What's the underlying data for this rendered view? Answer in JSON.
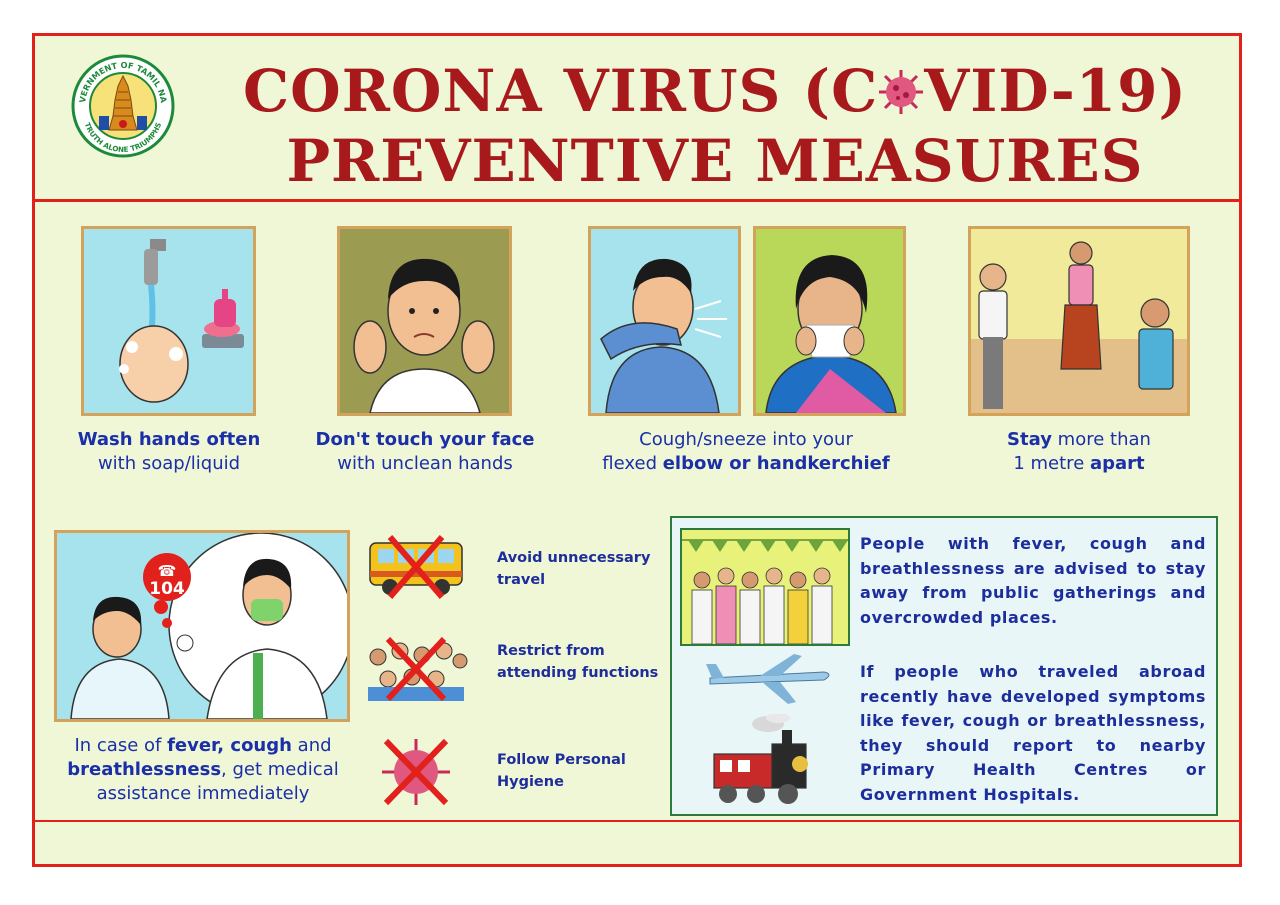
{
  "header": {
    "title_line1_a": "CORONA VIRUS (C",
    "title_line1_b": "VID-19)",
    "title_line2": "PREVENTIVE MEASURES",
    "seal_top_text": "GOVERNMENT OF TAMIL NADU",
    "seal_bottom_text": "TRUTH ALONE TRIUMPHS"
  },
  "measures": [
    {
      "bold": "Wash hands often",
      "rest": "with soap/liquid"
    },
    {
      "bold": "Don't touch your face",
      "rest": "with unclean hands"
    },
    {
      "plain": "Cough/sneeze into your",
      "plain2": "flexed ",
      "bold": "elbow or handkerchief"
    },
    {
      "bold": "Stay",
      "plain": " more than",
      "plain2": "1 metre ",
      "bold2": "apart"
    }
  ],
  "medical": {
    "badge": "104",
    "line1_a": "In case of ",
    "line1_b": "fever, cough",
    "line1_c": " and",
    "line2_a": "breathlessness",
    "line2_b": ", get medical",
    "line3": "assistance immediately"
  },
  "avoid": [
    {
      "line1": "Avoid unnecessary",
      "line2": "travel"
    },
    {
      "line1": "Restrict from",
      "line2": "attending functions"
    },
    {
      "line1": "Follow Personal",
      "line2": "Hygiene"
    }
  ],
  "info": {
    "para1": "People with fever, cough and breathlessness are advised to stay away from public gatherings and overcrowded places.",
    "para2": "If people who traveled abroad recently have developed symptoms like fever, cough or breathlessness, they should report to nearby Primary Health Centres or Government Hospitals."
  },
  "colors": {
    "title": "#a8191c",
    "border": "#e2211c",
    "text": "#1a2fa8",
    "background": "#f0f7d6"
  }
}
